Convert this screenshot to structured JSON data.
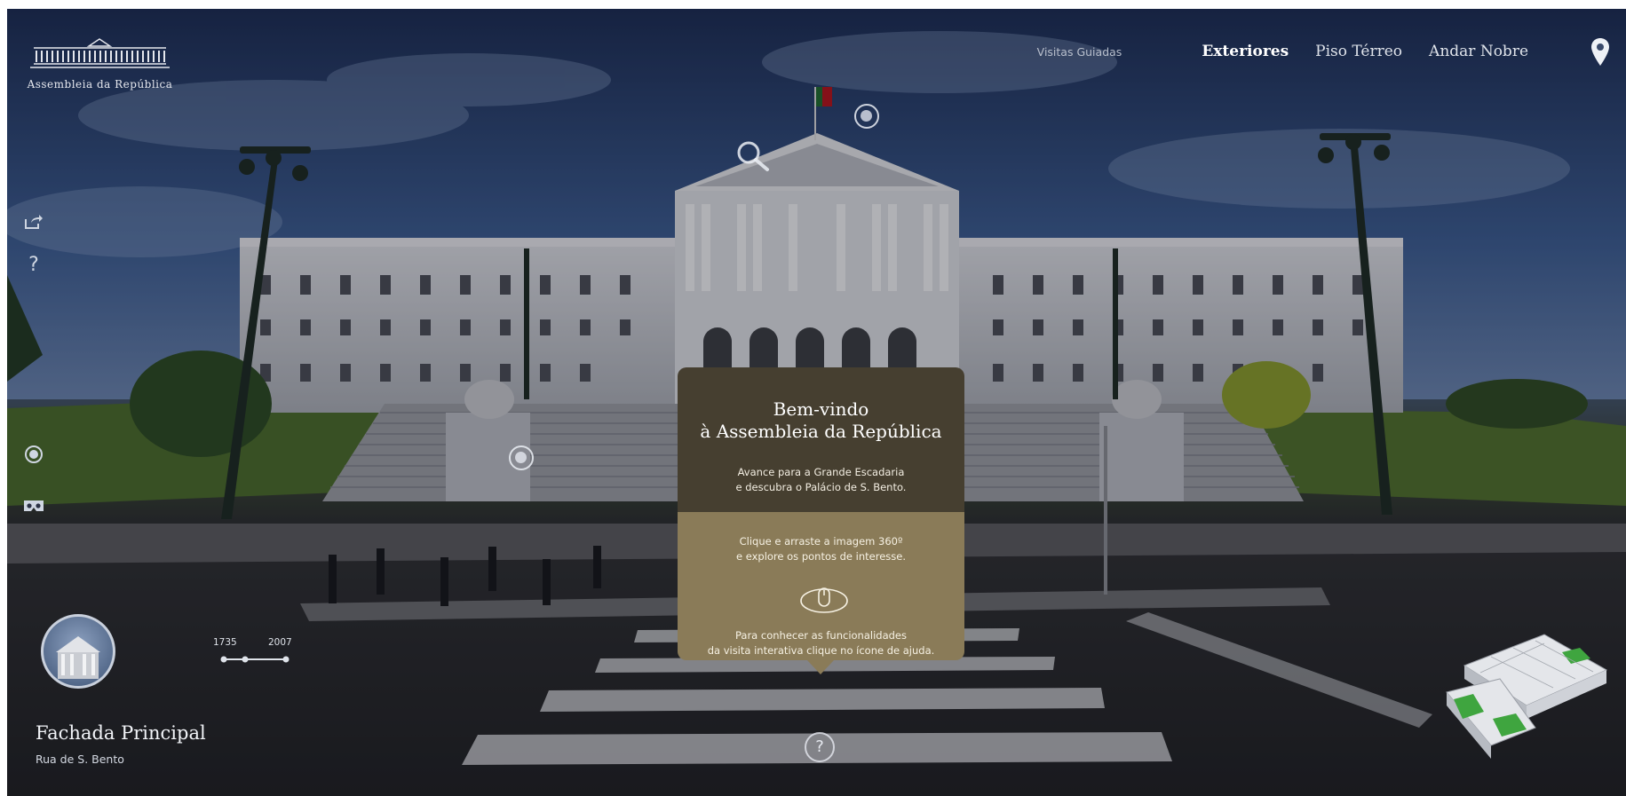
{
  "brand": {
    "name": "Assembleia da República"
  },
  "nav": {
    "guided_tours": "Visitas Guiadas",
    "items": [
      {
        "label": "Exteriores",
        "active": true
      },
      {
        "label": "Piso Térreo",
        "active": false
      },
      {
        "label": "Andar Nobre",
        "active": false
      }
    ]
  },
  "left_toolbar": {
    "share_icon": "share-icon",
    "help_icon": "help-icon",
    "hotspot_icon": "hotspot-icon",
    "vr_icon": "vr-headset-icon"
  },
  "welcome": {
    "title_line1": "Bem-vindo",
    "title_line2": "à Assembleia da República",
    "subtitle_line1": "Avance para a Grande Escadaria",
    "subtitle_line2": "e descubra o Palácio de S. Bento.",
    "drag_line1": "Clique e arraste a imagem 360º",
    "drag_line2": "e explore os pontos de interesse.",
    "help_line1": "Para conhecer as funcionalidades",
    "help_line2": "da visita interativa clique no ícone de ajuda.",
    "top_color": "#463f30",
    "bottom_color": "#8a7b58"
  },
  "timeline": {
    "start": "1735",
    "end": "2007"
  },
  "location": {
    "title": "Fachada Principal",
    "subtitle": "Rua de S. Bento"
  },
  "help_button": {
    "label": "?"
  },
  "colors": {
    "flag_green": "#1f6b2f",
    "flag_red": "#b3141b",
    "minimap_green": "#3fa53f"
  }
}
